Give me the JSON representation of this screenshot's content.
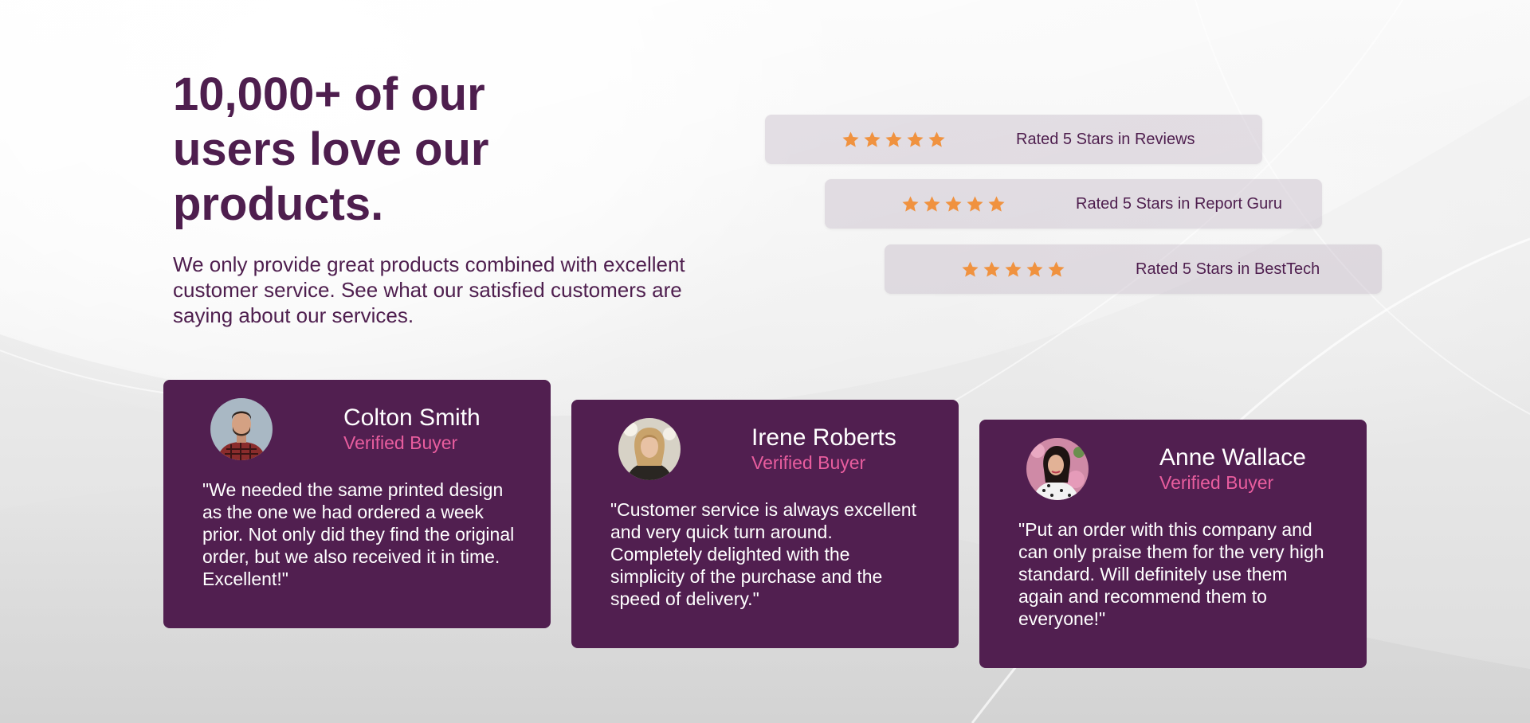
{
  "hero": {
    "headline": "10,000+ of our users love our products.",
    "subtext": "We only provide great products combined with excellent customer service. See what our satisfied customers are saying about our services."
  },
  "ratings": [
    {
      "stars": 5,
      "label": "Rated 5 Stars in Reviews"
    },
    {
      "stars": 5,
      "label": "Rated 5 Stars in Report Guru"
    },
    {
      "stars": 5,
      "label": "Rated 5 Stars in BestTech"
    }
  ],
  "testimonials": [
    {
      "name": "Colton Smith",
      "badge": "Verified Buyer",
      "quote": "\"We needed the same printed design as the one we had ordered a week prior. Not only did they find the original order, but we also received it in time. Excellent!\""
    },
    {
      "name": "Irene Roberts",
      "badge": "Verified Buyer",
      "quote": "\"Customer service is always excellent and very quick turn around. Completely delighted with the simplicity of the purchase and the speed of delivery.\""
    },
    {
      "name": "Anne Wallace",
      "badge": "Verified Buyer",
      "quote": "\"Put an order with this company and can only praise them for the very high standard. Will definitely use them again and recommend them to everyone!\""
    }
  ],
  "colors": {
    "brand": "#511f50",
    "heading": "#4e1e4e",
    "accent": "#e85d9e",
    "star": "#f0923f",
    "rating_bg": "#dcd6dd"
  },
  "icons": {
    "rating_star": "star-icon"
  }
}
